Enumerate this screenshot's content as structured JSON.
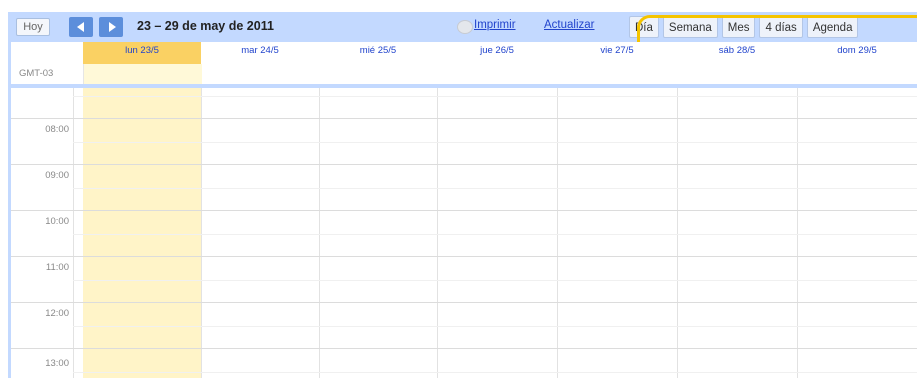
{
  "toolbar": {
    "today_label": "Hoy",
    "date_range": "23 – 29 de may de 2011",
    "print_label": "Imprimir",
    "refresh_label": "Actualizar"
  },
  "view_tabs": [
    "Día",
    "Semana",
    "Mes",
    "4 días",
    "Agenda"
  ],
  "calendar": {
    "timezone_label": "GMT-03",
    "days": [
      "lun 23/5",
      "mar 24/5",
      "mié 25/5",
      "jue 26/5",
      "vie 27/5",
      "sáb 28/5",
      "dom 29/5"
    ],
    "today_index": 0,
    "hours": [
      "08:00",
      "09:00",
      "10:00",
      "11:00",
      "12:00",
      "13:00"
    ]
  },
  "colors": {
    "toolbar_bg": "#c3d9ff",
    "nav_button": "#5c8edb",
    "today_header": "#fad163",
    "today_column": "#fff4c8",
    "highlight": "#f5c400",
    "link": "#2244cc"
  }
}
